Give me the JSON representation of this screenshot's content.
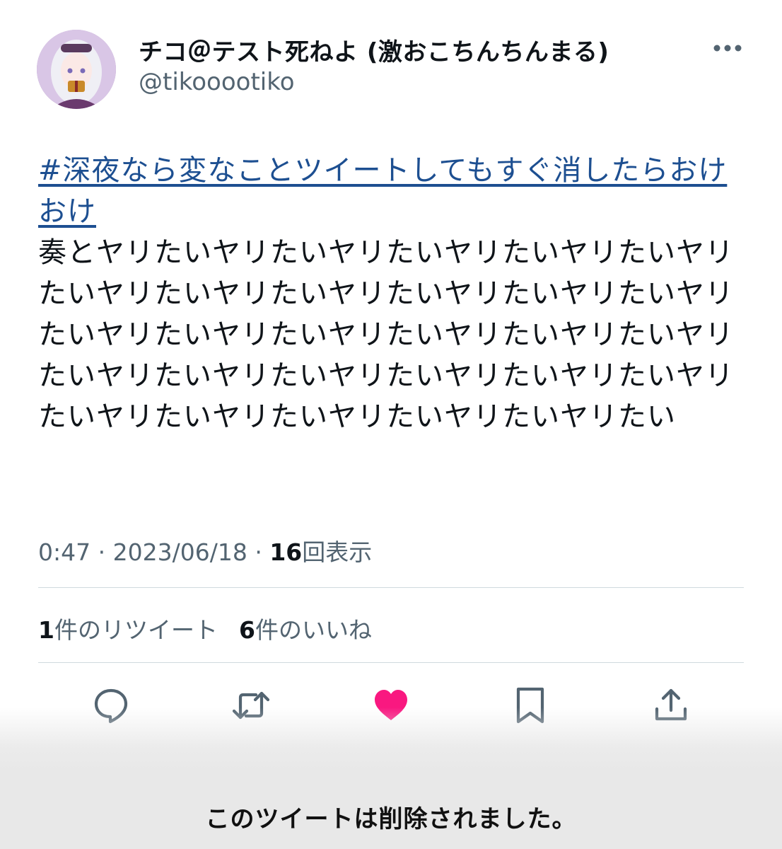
{
  "author": {
    "display_name": "チコ＠テスト死ねよ (激おこちんちんまる)",
    "handle": "@tikooootiko"
  },
  "tweet": {
    "hashtag": "#深夜なら変なことツイートしてもすぐ消したらおけおけ",
    "body": "奏とヤリたいヤリたいヤリたいヤリたいヤリたいヤリたいヤリたいヤリたいヤリたいヤリたいヤリたいヤリたいヤリたいヤリたいヤリたいヤリたいヤリたいヤリたいヤリたいヤリたいヤリたいヤリたいヤリたいヤリたいヤリたいヤリたいヤリたいヤリたいヤリたい"
  },
  "meta": {
    "time": "0:47",
    "separator": "·",
    "date": "2023/06/18",
    "views_count": "16",
    "views_label": "回表示"
  },
  "stats": {
    "retweets_count": "1",
    "retweets_label": "件のリツイート",
    "likes_count": "6",
    "likes_label": "件のいいね"
  },
  "actions": [
    {
      "name": "reply",
      "icon": "speech-bubble-icon"
    },
    {
      "name": "retweet",
      "icon": "retweet-arrows-icon"
    },
    {
      "name": "like",
      "icon": "heart-icon",
      "active": true,
      "color": "#f91880"
    },
    {
      "name": "bookmark",
      "icon": "bookmark-icon"
    },
    {
      "name": "share",
      "icon": "share-upload-icon"
    }
  ],
  "notice": {
    "text": "このツイートは削除されました。"
  },
  "colors": {
    "hashtag": "#1d4f91",
    "secondary_text": "#536471",
    "like_active": "#f91880",
    "icon": "#536471"
  }
}
